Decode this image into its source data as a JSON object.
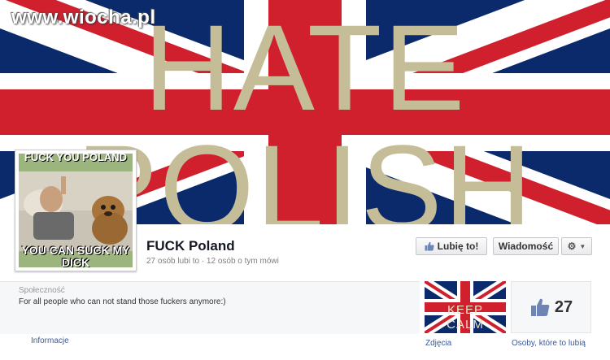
{
  "watermark": "www.wiocha.pl",
  "cover": {
    "line1": "HATE",
    "line2": "POLISH"
  },
  "profile_pic": {
    "top_text": "FUCK YOU POLAND",
    "bottom_text": "YOU CAN SUCK MY DICK"
  },
  "page": {
    "name": "FUCK Poland",
    "stats": "27 osób lubi to · 12 osób o tym mówi"
  },
  "buttons": {
    "like": "Lubię to!",
    "message": "Wiadomość"
  },
  "about": {
    "category": "Społeczność",
    "description": "For all people who can not stand those fuckers anymore:)",
    "tab_label": "Informacje"
  },
  "photos": {
    "thumb_line1": "KEEP",
    "thumb_line2": "CALM",
    "label": "Zdjęcia"
  },
  "likes": {
    "count": "27",
    "label": "Osoby, które to lubią"
  },
  "colors": {
    "flag_blue": "#0a2a6b",
    "flag_red": "#d0202e",
    "cover_text": "#c5bd98",
    "link": "#3b5998"
  }
}
